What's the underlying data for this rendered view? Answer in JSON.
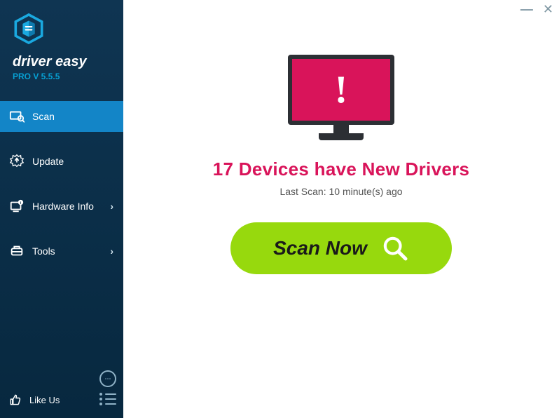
{
  "brand": {
    "name": "driver easy",
    "version": "PRO V 5.5.5"
  },
  "sidebar": {
    "items": [
      {
        "label": "Scan",
        "icon": "scan-icon",
        "active": true,
        "chevron": false
      },
      {
        "label": "Update",
        "icon": "update-icon",
        "active": false,
        "chevron": false
      },
      {
        "label": "Hardware Info",
        "icon": "hardware-info-icon",
        "active": false,
        "chevron": true
      },
      {
        "label": "Tools",
        "icon": "tools-icon",
        "active": false,
        "chevron": true
      }
    ],
    "like_us": "Like Us"
  },
  "main": {
    "headline": "17 Devices have New Drivers",
    "last_scan": "Last Scan: 10 minute(s) ago",
    "scan_button": "Scan Now",
    "alert_glyph": "!"
  },
  "colors": {
    "accent_pink": "#d9145a",
    "accent_green": "#97d90d",
    "sidebar_active": "#1385c7"
  }
}
